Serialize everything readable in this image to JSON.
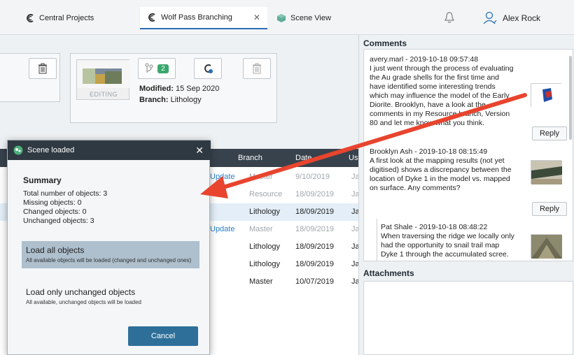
{
  "tabs": [
    {
      "label": "Central Projects"
    },
    {
      "label": "Wolf Pass Branching"
    },
    {
      "label": "Scene View"
    }
  ],
  "tab_close_glyph": "✕",
  "user": {
    "name": "Alex Rock"
  },
  "version_card": {
    "editing_label": "EDITING",
    "branch_count": "2",
    "modified_label": "Modified:",
    "modified_value": "15 Sep 2020",
    "branch_label": "Branch:",
    "branch_value": "Lithology"
  },
  "table": {
    "headers": [
      "Branch",
      "Date",
      "Us"
    ],
    "rows": [
      {
        "action": "Update",
        "branch": "Master",
        "date": "9/10/2019",
        "user": "Ja",
        "faded": true
      },
      {
        "action": "",
        "branch": "Resource",
        "date": "18/09/2019",
        "user": "Ja",
        "faded": true
      },
      {
        "action": "",
        "branch": "Lithology",
        "date": "18/09/2019",
        "user": "Ja",
        "faded": false,
        "selected": true
      },
      {
        "action": "Update",
        "branch": "Master",
        "date": "18/09/2019",
        "user": "Ja",
        "faded": true
      },
      {
        "action": "",
        "branch": "Lithology",
        "date": "18/09/2019",
        "user": "Ja",
        "faded": false
      },
      {
        "action": "",
        "branch": "Lithology",
        "date": "18/09/2019",
        "user": "Ja",
        "faded": false
      },
      {
        "action": "",
        "branch": "Master",
        "date": "10/07/2019",
        "user": "Ja",
        "faded": false
      }
    ]
  },
  "comments_panel": {
    "title": "Comments",
    "comments": [
      {
        "header": "avery.marl - 2019-10-18 09:57:48",
        "lines": [
          "I just went through the process of evaluating",
          "the Au grade shells for the first time and",
          "have identified some interesting trends",
          "which may influence the model of the Early",
          "Diorite. Brooklyn, have a look at the",
          "comments in my Resource branch, Version",
          "80 and let me know what you think."
        ]
      },
      {
        "header": "Brooklyn Ash - 2019-10-18 08:15:49",
        "lines": [
          "A first look at the mapping results (not yet",
          "digitised) shows a discrepancy between the",
          "location of Dyke 1 in the model vs. mapped",
          "on surface. Any comments?"
        ]
      },
      {
        "header": "Pat Shale - 2019-10-18 08:48:22",
        "lines": [
          "When traversing the ridge we locally only",
          "had the opportunity to snail trail map",
          "Dyke 1 through the accumulated scree."
        ]
      }
    ],
    "reply_label": "Reply"
  },
  "attachments": {
    "title": "Attachments"
  },
  "dialog": {
    "title": "Scene loaded",
    "summary_title": "Summary",
    "stats": [
      "Total number of objects: 3",
      "Missing objects: 0",
      "Changed objects: 0",
      "Unchanged objects: 3"
    ],
    "option1_title": "Load all objects",
    "option1_desc": "All available objects will be loaded (changed and unchanged ones)",
    "option2_title": "Load only unchanged objects",
    "option2_desc": "All available, unchanged objects will be loaded",
    "cancel_label": "Cancel",
    "close_glyph": "✕"
  },
  "colors": {
    "accent": "#2a6db6",
    "arrow": "#e8442e",
    "dialog_button": "#2e6f99"
  }
}
